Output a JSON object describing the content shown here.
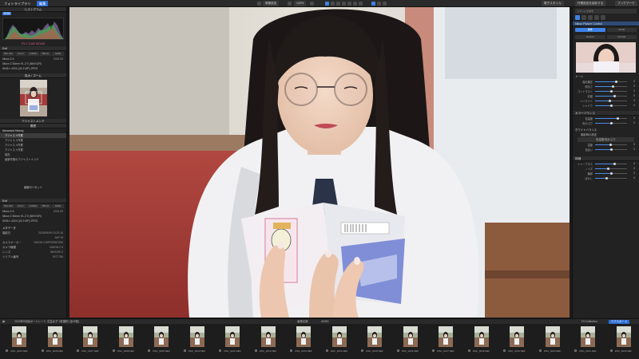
{
  "topbar": {
    "tabs": [
      "フォトライブラリ",
      "編集"
    ],
    "left_icon_label": "",
    "center_buttons": [
      "現像設定",
      "143%"
    ],
    "right_buttons": [
      "電子スタイル",
      "作業設定を保存する",
      "ブックマーク"
    ]
  },
  "left_panel": {
    "histogram_title": "ヒストグラム",
    "histogram_mode": "RGB",
    "histo_values": "F/1.2  1/160  ISO100",
    "exif_title": "Exif",
    "exif_buttons": [
      "ISO 100",
      "F/1.2",
      "1/200s",
      "85mm",
      "RAW"
    ],
    "exif_rows": [
      {
        "label": "Nikon Z 6",
        "value": "2023.09"
      },
      {
        "label": "Nikon Z 50mm f/1.2 S (NIKKOR)",
        "value": ""
      },
      {
        "label": "6048 x 4024 (24.3 MP)  JPEG",
        "value": ""
      }
    ],
    "navigator_title": "拡大 / ズーム",
    "preset_title": "アジャストメンテ",
    "history_title": "履歴",
    "history_section": "Advanced History",
    "history_items": [
      "アジャスト作業",
      "アジャスト作業",
      "アジャスト作業",
      "アジャスト作業",
      "保存",
      "最新作業のアジャストメンテ"
    ],
    "history_selected": 0,
    "reset_button": "最新のリセット",
    "exif2_title": "Exif",
    "meta_title": "メタデータ",
    "meta_rows": [
      {
        "label": "撮影日",
        "value": "2023/09/09 13:22:10"
      },
      {
        "label": "",
        "value": "JMT+9"
      },
      {
        "label": "カメラメーカー",
        "value": "NIKON CORPORATION"
      },
      {
        "label": "カメラ機種",
        "value": "NIKON Z 6"
      },
      {
        "label": "レンズ",
        "value": "NIKKOR Z"
      },
      {
        "label": "シリアル番号",
        "value": "3077755"
      }
    ]
  },
  "right_panel": {
    "search_placeholder": "スタイルを検索",
    "preset_name": "Nikon Picture Control",
    "preset_tabs": [
      "標準",
      "VIVID",
      "Neutral",
      "Portrait"
    ],
    "tone_title": "トーン",
    "sliders": [
      {
        "label": "露出補正",
        "value": 0.65,
        "text": "0"
      },
      {
        "label": "明るさ",
        "value": 0.55,
        "text": "0"
      },
      {
        "label": "コントラスト",
        "value": 0.5,
        "text": "0"
      },
      {
        "label": "彩度",
        "value": 0.6,
        "text": "0"
      },
      {
        "label": "ハイライト",
        "value": 0.45,
        "text": "0"
      },
      {
        "label": "シャドウ",
        "value": 0.5,
        "text": "0"
      }
    ],
    "color_title": "カラーバランス",
    "sliders2": [
      {
        "label": "色温度",
        "value": 0.7,
        "text": "0"
      },
      {
        "label": "色かぶり",
        "value": 0.5,
        "text": "0"
      }
    ],
    "wb_title": "ホワイトバランス",
    "wb_rows": [
      "撮影時の設定",
      "色温度/色かぶり"
    ],
    "sliders3": [
      {
        "label": "温度",
        "value": 0.48,
        "text": "0"
      },
      {
        "label": "色合い",
        "value": 0.52,
        "text": "0"
      }
    ],
    "detail_title": "詳細",
    "sliders4": [
      {
        "label": "シャープネス",
        "value": 0.6,
        "text": "0"
      },
      {
        "label": "ノイズ",
        "value": 0.4,
        "text": "0"
      },
      {
        "label": "輪郭",
        "value": 0.5,
        "text": "0"
      },
      {
        "label": "ぼかし",
        "value": 0.35,
        "text": "0"
      }
    ]
  },
  "filmstrip": {
    "info_left": "2023年9月版ポートレート 文芸女子  1枚選択 (全29枚)",
    "info_center": "画像名順",
    "sort_label": "UDSD",
    "right_label": "Fit Collection",
    "export_button": "エクスポート",
    "items": [
      "DSC_0203.NEF",
      "DSC_0206.NEF",
      "DSC_0207.NEF",
      "DSC_0208.NEF",
      "DSC_0209.NEF",
      "DSC_0210.NEF",
      "DSC_0211.NEF",
      "DSC_0212.NEF",
      "DSC_0213.NEF",
      "DSC_0214.NEF",
      "DSC_0215.NEF",
      "DSC_0216.NEF",
      "DSC_0217.NEF",
      "DSC_0218.NEF",
      "DSC_0219.NEF",
      "DSC_0220.NEF",
      "DSC_0221.NEF",
      "DSC_0222.NEF"
    ]
  },
  "colors": {
    "accent": "#2f6fd6",
    "panel": "#222222",
    "bar": "#2a2a2a"
  }
}
